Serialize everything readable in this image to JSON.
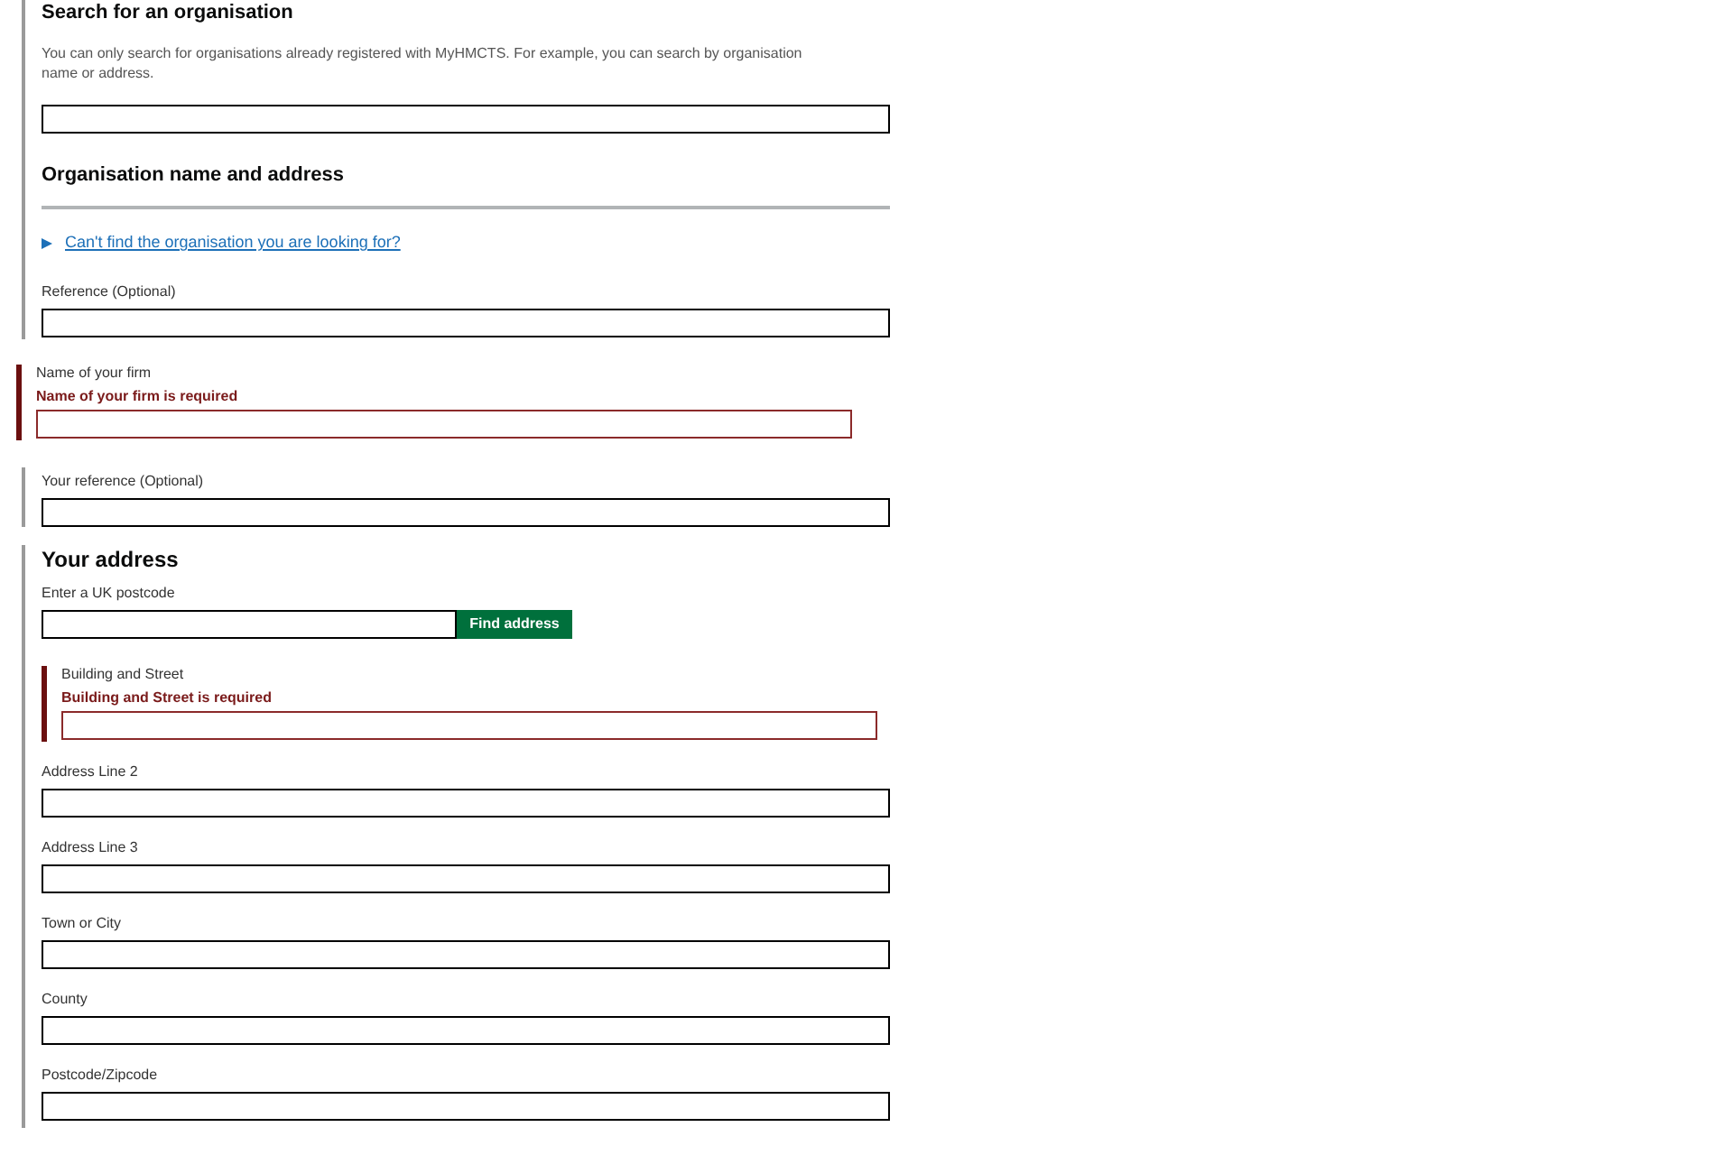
{
  "organisation_search": {
    "heading": "Search for an organisation",
    "hint": "You can only search for organisations already registered with MyHMCTS. For example, you can search by organisation name or address.",
    "subheading": "Organisation name and address",
    "details_link": "Can't find the organisation you are looking for?",
    "reference_field": {
      "label": "Reference (Optional)"
    }
  },
  "firm_name_field": {
    "label": "Name of your firm",
    "error": "Name of your firm is required"
  },
  "your_reference_field": {
    "label": "Your reference (Optional)"
  },
  "address": {
    "heading": "Your address",
    "postcode_label": "Enter a UK postcode",
    "find_button": "Find address",
    "fields": [
      {
        "label": "Building and Street",
        "error": "Building and Street is required"
      },
      {
        "label": "Address Line 2"
      },
      {
        "label": "Address Line 3"
      },
      {
        "label": "Town or City"
      },
      {
        "label": "County"
      },
      {
        "label": "Postcode/Zipcode"
      }
    ]
  }
}
